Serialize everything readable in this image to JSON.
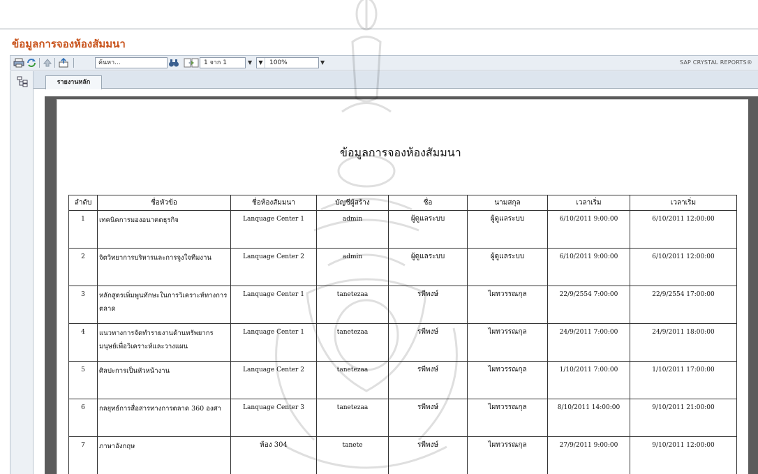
{
  "page": {
    "title": "ข้อมูลการจองห้องสัมมนา"
  },
  "toolbar": {
    "search_value": "ค้นหา...",
    "page_indicator": "1 จาก 1",
    "zoom_value": "100%",
    "brand": "SAP CRYSTAL REPORTS®",
    "icons": [
      "print-icon",
      "refresh-icon",
      "up-icon",
      "export-icon",
      "binoculars-icon",
      "page-prev-icon",
      "page-next-icon"
    ]
  },
  "tabs": [
    {
      "label": "รายงานหลัก"
    }
  ],
  "report": {
    "title": "ข้อมูลการจองห้องสัมมนา",
    "columns": [
      "ลำดับ",
      "ชื่อหัวข้อ",
      "ชื่อห้องสัมมนา",
      "บัญชีผู้สร้าง",
      "ชื่อ",
      "นามสกุล",
      "เวลาเริ่ม",
      "เวลาเริ่ม"
    ],
    "rows": [
      {
        "no": "1",
        "topic": "เทคนิคการมองอนาคตธุรกิจ",
        "room": "Lanquage Center 1",
        "account": "admin",
        "first": "ผู้ดูแลระบบ",
        "last": "ผู้ดูแลระบบ",
        "start": "6/10/2011  9:00:00",
        "end": "6/10/2011  12:00:00"
      },
      {
        "no": "2",
        "topic": "จิตวิทยาการบริหารและการจูงใจทีมงาน",
        "room": "Lanquage Center 2",
        "account": "admin",
        "first": "ผู้ดูแลระบบ",
        "last": "ผู้ดูแลระบบ",
        "start": "6/10/2011  9:00:00",
        "end": "6/10/2011  12:00:00"
      },
      {
        "no": "3",
        "topic": "หลักสูตรเพิ่มพูนทักษะในการวิเคราะห์ทางการตลาด",
        "room": "Lanquage Center 1",
        "account": "tanetezaa",
        "first": "รพีพงษ์",
        "last": "ไผทวรรณกุล",
        "start": "22/9/2554  7:00:00",
        "end": "22/9/2554  17:00:00"
      },
      {
        "no": "4",
        "topic": "แนวทางการจัดทำรายงานด้านทรัพยากรมนุษย์เพื่อวิเคราะห์และวางแผน",
        "room": "Lanquage Center 1",
        "account": "tanetezaa",
        "first": "รพีพงษ์",
        "last": "ไผทวรรณกุล",
        "start": "24/9/2011  7:00:00",
        "end": "24/9/2011  18:00:00"
      },
      {
        "no": "5",
        "topic": "ศิลปะการเป็นหัวหน้างาน",
        "room": "Lanquage Center 2",
        "account": "tanetezaa",
        "first": "รพีพงษ์",
        "last": "ไผทวรรณกุล",
        "start": "1/10/2011  7:00:00",
        "end": "1/10/2011  17:00:00"
      },
      {
        "no": "6",
        "topic": "กลยุทธ์การสื่อสารทางการตลาด 360 องศา",
        "room": "Lanquage Center 3",
        "account": "tanetezaa",
        "first": "รพีพงษ์",
        "last": "ไผทวรรณกุล",
        "start": "8/10/2011  14:00:00",
        "end": "9/10/2011  21:00:00"
      },
      {
        "no": "7",
        "topic": "ภาษาอังกฤษ",
        "room": "ห้อง 304",
        "account": "tanete",
        "first": "รพีพงษ์",
        "last": "ไผทวรรณกุล",
        "start": "27/9/2011  9:00:00",
        "end": "9/10/2011  12:00:00"
      }
    ]
  },
  "colors": {
    "title_accent": "#c8521a",
    "toolbar_bg": "#e9eef4",
    "viewer_bg": "#5c5c5c"
  }
}
